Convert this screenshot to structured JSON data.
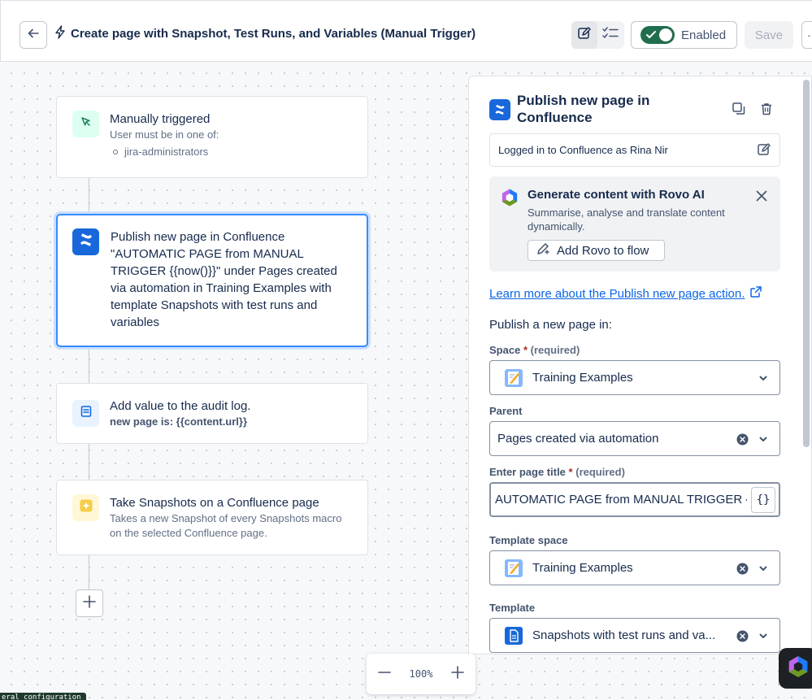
{
  "header": {
    "title": "Create page with Snapshot, Test Runs, and Variables (Manual Trigger)",
    "enabled_label": "Enabled",
    "save_label": "Save",
    "more_label": "··"
  },
  "flow": {
    "trigger": {
      "title": "Manually triggered",
      "subtitle": "User must be in one of:",
      "groups": [
        "jira-administrators"
      ]
    },
    "publish": {
      "title": "Publish new page in Confluence",
      "description": "\"AUTOMATIC PAGE from MANUAL TRIGGER {{now()}}\" under Pages created via automation in Training Examples with template Snapshots with test runs and variables"
    },
    "audit": {
      "title": "Add value to the audit log.",
      "value": "new page is: {{content.url}}"
    },
    "snapshots": {
      "title": "Take Snapshots on a Confluence page",
      "description": "Takes a new Snapshot of every Snapshots macro on the selected Confluence page."
    }
  },
  "zoom": {
    "level": "100%"
  },
  "status_pill": "eral_configuration",
  "panel": {
    "title": "Publish new page in Confluence",
    "logged_in": "Logged in to Confluence as Rina Nir",
    "rovo": {
      "title": "Generate content with Rovo AI",
      "description": "Summarise, analyse and translate content dynamically.",
      "button": "Add Rovo to flow"
    },
    "learn_link": "Learn more about the Publish new page action.",
    "section": "Publish a new page in:",
    "fields": {
      "space": {
        "label": "Space",
        "required": "*",
        "required_text": "(required)",
        "value": "Training Examples"
      },
      "parent": {
        "label": "Parent",
        "value": "Pages created via automation"
      },
      "page_title": {
        "label": "Enter page title",
        "required": "*",
        "required_text": "(required)",
        "value": "AUTOMATIC PAGE from MANUAL TRIGGER {{now()}}",
        "var_button": "{}"
      },
      "template_space": {
        "label": "Template space",
        "value": "Training Examples"
      },
      "template": {
        "label": "Template",
        "value": "Snapshots with test runs and va..."
      }
    }
  },
  "colors": {
    "accent": "#0c66e4",
    "toggle_on": "#216e4e",
    "confluence_blue": "#1868db",
    "selected_border": "#388bff"
  }
}
